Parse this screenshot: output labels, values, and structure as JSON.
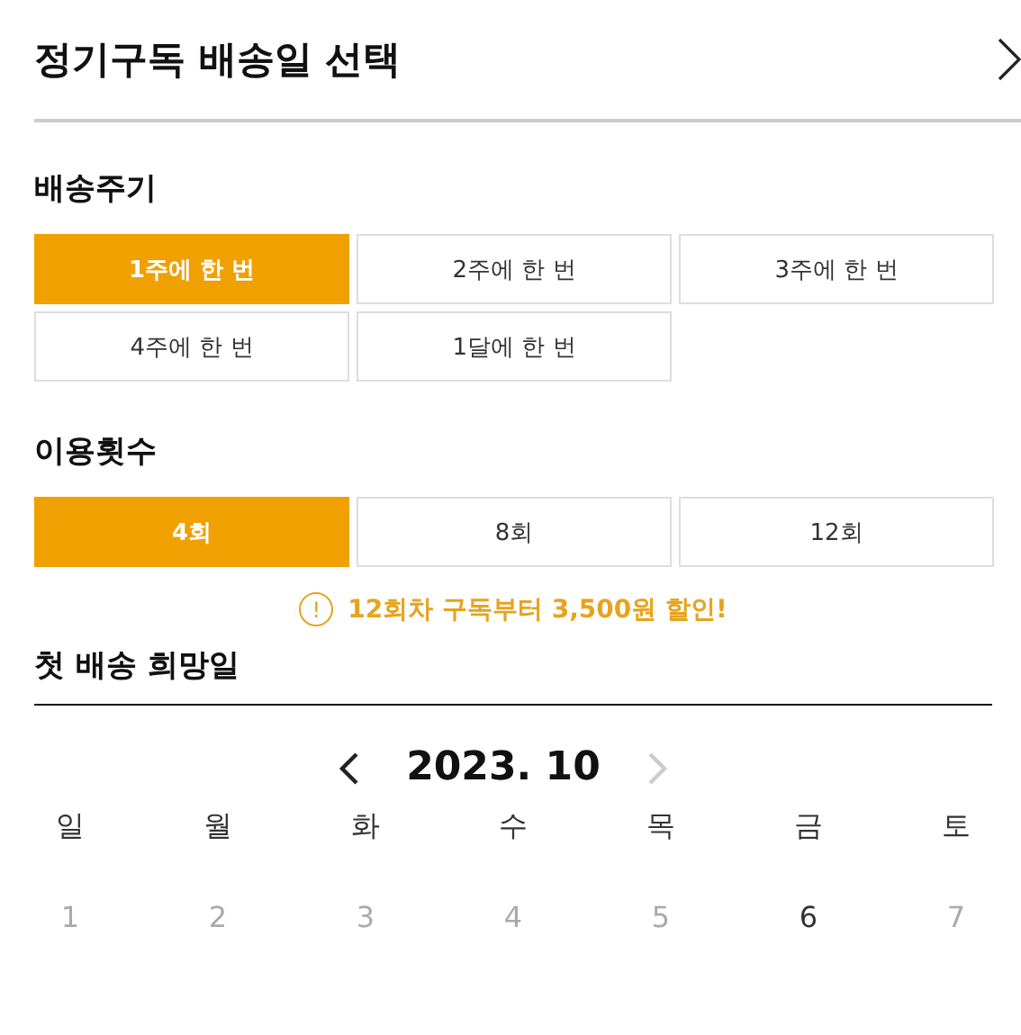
{
  "title": "정기구독 배송일 선택",
  "cycle": {
    "label": "배송주기",
    "options": [
      {
        "label": "1주에 한 번",
        "selected": true
      },
      {
        "label": "2주에 한 번",
        "selected": false
      },
      {
        "label": "3주에 한 번",
        "selected": false
      },
      {
        "label": "4주에 한 번",
        "selected": false
      },
      {
        "label": "1달에 한 번",
        "selected": false
      }
    ]
  },
  "count": {
    "label": "이용횟수",
    "options": [
      {
        "label": "4회",
        "selected": true
      },
      {
        "label": "8회",
        "selected": false
      },
      {
        "label": "12회",
        "selected": false
      }
    ]
  },
  "notice": {
    "icon": "!",
    "text": "12회차 구독부터 3,500원 할인!"
  },
  "first_delivery": {
    "label": "첫 배송 희망일",
    "calendar": {
      "month": "2023. 10",
      "prev_disabled": false,
      "next_disabled": true,
      "weekdays": [
        "일",
        "월",
        "화",
        "수",
        "목",
        "금",
        "토"
      ],
      "dates": [
        {
          "label": "1",
          "disabled": true
        },
        {
          "label": "2",
          "disabled": true
        },
        {
          "label": "3",
          "disabled": true
        },
        {
          "label": "4",
          "disabled": true
        },
        {
          "label": "5",
          "disabled": true
        },
        {
          "label": "6",
          "disabled": false
        },
        {
          "label": "7",
          "disabled": true
        }
      ]
    }
  }
}
